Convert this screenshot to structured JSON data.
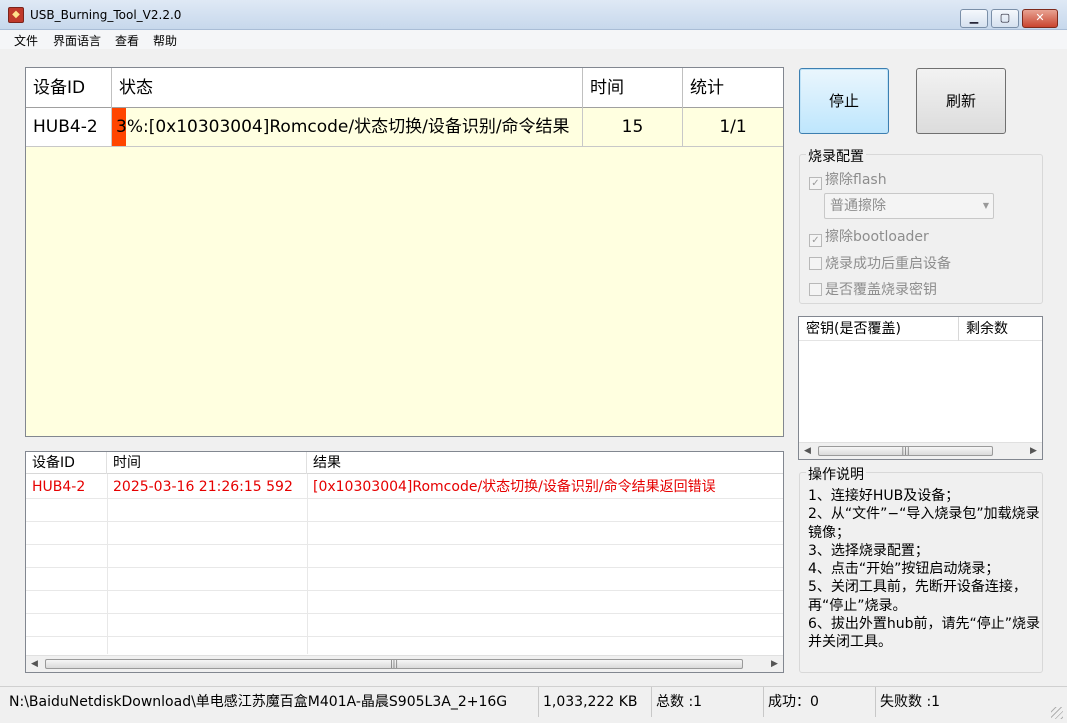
{
  "window": {
    "title": "USB_Burning_Tool_V2.2.0"
  },
  "menu": [
    "文件",
    "界面语言",
    "查看",
    "帮助"
  ],
  "device_table": {
    "headers": [
      "设备ID",
      "状态",
      "时间",
      "统计"
    ],
    "rows": [
      {
        "id": "HUB4-2",
        "progress_percent": 3,
        "status": "3%:[0x10303004]Romcode/状态切换/设备识别/命令结果",
        "time": "15",
        "stats": "1/1",
        "progress_color": "#ff4500"
      }
    ]
  },
  "log_table": {
    "headers": [
      "设备ID",
      "时间",
      "结果"
    ],
    "rows": [
      {
        "id": "HUB4-2",
        "time": "2025-03-16 21:26:15 592",
        "result": "[0x10303004]Romcode/状态切换/设备识别/命令结果返回错误"
      }
    ]
  },
  "buttons": {
    "stop": "停止",
    "refresh": "刷新"
  },
  "burn_config": {
    "title": "烧录配置",
    "erase_flash": {
      "label": "擦除flash",
      "checked": true
    },
    "erase_mode": "普通擦除",
    "erase_bootloader": {
      "label": "擦除bootloader",
      "checked": true
    },
    "reboot_after": {
      "label": "烧录成功后重启设备",
      "checked": false
    },
    "overwrite_key": {
      "label": "是否覆盖烧录密钥",
      "checked": false
    },
    "check_mark": "✓"
  },
  "key_table": {
    "headers": [
      "密钥(是否覆盖)",
      "剩余数"
    ]
  },
  "instructions": {
    "title": "操作说明",
    "lines": [
      "1、连接好HUB及设备；",
      "2、从“文件”−“导入烧录包”加载烧录镜像；",
      "3、选择烧录配置；",
      "4、点击“开始”按钮启动烧录；",
      "5、关闭工具前，先断开设备连接，再“停止”烧录。",
      "6、拔出外置hub前，请先“停止”烧录并关闭工具。"
    ]
  },
  "statusbar": {
    "path": "N:\\BaiduNetdiskDownload\\单电感江苏魔百盒M401A-晶晨S905L3A_2+16G",
    "size": "1,033,222 KB",
    "total": "总数 :1",
    "success": "成功：0",
    "failed": "失败数 :1"
  },
  "colors": {
    "error_text": "#e60000",
    "table_bg": "#ffffe0"
  }
}
